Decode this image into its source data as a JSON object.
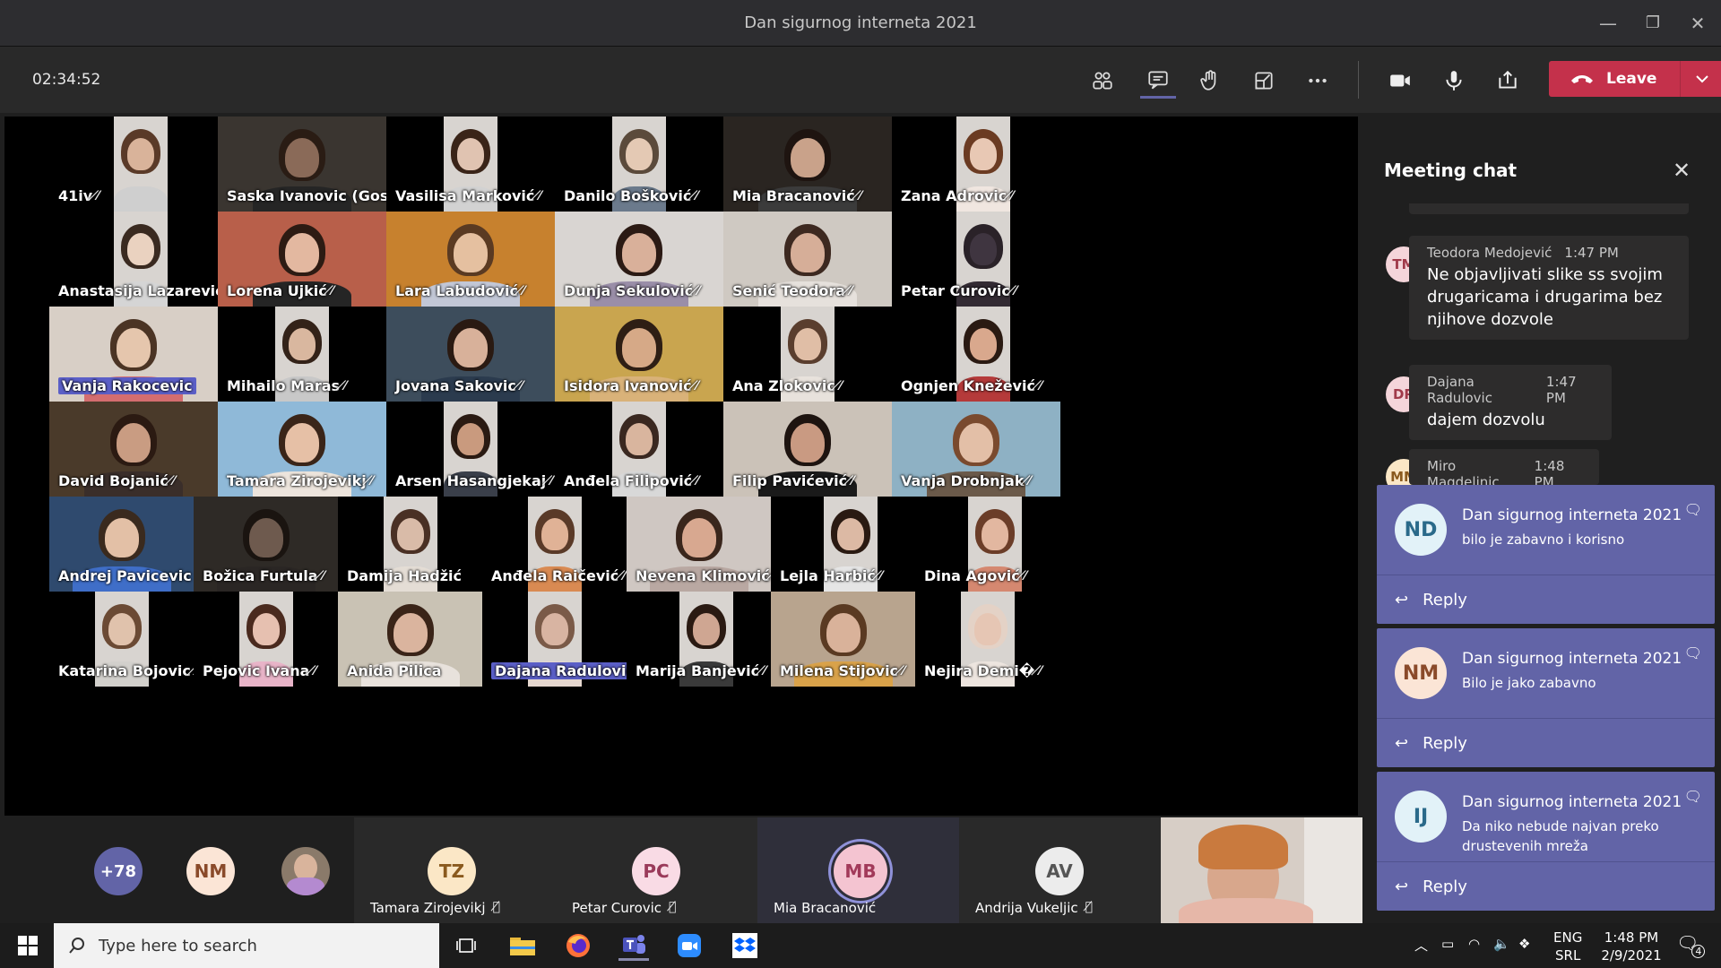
{
  "window": {
    "title": "Dan sigurnog interneta 2021",
    "minimize": "—",
    "restore": "❐",
    "close": "✕"
  },
  "toolbar": {
    "timer": "02:34:52",
    "leave_label": "Leave"
  },
  "tiles": [
    {
      "name": "41iv",
      "bg": "#000000",
      "face": "#d9b39a",
      "hair": "#5a3a28",
      "shirt": "#cfcfcf",
      "cam": "narrow",
      "mic": true
    },
    {
      "name": "Saska Ivanovic (Gost)",
      "bg": "#3a3530",
      "face": "#8a6a58",
      "hair": "#2a1c14",
      "shirt": "#252525",
      "cam": "full",
      "mic": true
    },
    {
      "name": "Vasilisa Marković",
      "bg": "#000000",
      "face": "#e0c3b1",
      "hair": "#3a2418",
      "shirt": "#d2d2d2",
      "cam": "narrow",
      "mic": true
    },
    {
      "name": "Danilo Bošković",
      "bg": "#000000",
      "face": "#e4c9b4",
      "hair": "#5b4a3b",
      "shirt": "#6b7a8c",
      "cam": "narrow",
      "mic": true
    },
    {
      "name": "Mia Bracanović",
      "bg": "#2a2521",
      "face": "#c9a28a",
      "hair": "#1e1410",
      "shirt": "#3b3b3b",
      "cam": "full",
      "mic": true
    },
    {
      "name": "Zana Adrovic",
      "bg": "#000000",
      "face": "#e8c8b4",
      "hair": "#6b3b22",
      "shirt": "#f0e6e0",
      "cam": "narrow",
      "mic": true
    },
    {
      "name": "Anastasija Lazarević",
      "bg": "#000000",
      "face": "#ead2c0",
      "hair": "#3a2a20",
      "shirt": "#d5d5d5",
      "cam": "narrow",
      "mic": true
    },
    {
      "name": "Lorena Ujkić",
      "bg": "#b85f4a",
      "face": "#e3b8a0",
      "hair": "#2d1b13",
      "shirt": "#252525",
      "cam": "full",
      "mic": true
    },
    {
      "name": "Lara Labudović",
      "bg": "#c7812e",
      "face": "#e5c0a0",
      "hair": "#5a3a22",
      "shirt": "#c2c7d6",
      "cam": "full",
      "mic": true
    },
    {
      "name": "Dunja Sekulović",
      "bg": "#d9d5d2",
      "face": "#d9b09a",
      "hair": "#2b1a14",
      "shirt": "#9a8ea8",
      "cam": "full",
      "mic": true
    },
    {
      "name": "Senić Teodora",
      "bg": "#cfc9c2",
      "face": "#d6ae98",
      "hair": "#3d2920",
      "shirt": "#e6e1dc",
      "cam": "full",
      "mic": true
    },
    {
      "name": "Petar Curovic",
      "bg": "#000000",
      "face": "#3f3540",
      "hair": "#2a2228",
      "shirt": "#332b33",
      "cam": "narrow",
      "mic": true
    },
    {
      "name": "Vanja Rakocevic",
      "bg": "#d8cfc6",
      "face": "#e5c6ad",
      "hair": "#4b3424",
      "shirt": "#d46d6f",
      "cam": "full",
      "mic": false,
      "hl": true
    },
    {
      "name": "Mihailo Maras",
      "bg": "#000000",
      "face": "#d9b79f",
      "hair": "#332218",
      "shirt": "#c8c8c8",
      "cam": "narrow",
      "mic": true
    },
    {
      "name": "Jovana Sakovic",
      "bg": "#3d4d5c",
      "face": "#d8b19a",
      "hair": "#2a1a12",
      "shirt": "#2b3b4e",
      "cam": "full",
      "mic": true
    },
    {
      "name": "Isidora Ivanović",
      "bg": "#c9a54f",
      "face": "#d6a987",
      "hair": "#2e1e14",
      "shirt": "#d9b279",
      "cam": "full",
      "mic": true
    },
    {
      "name": "Ana Zlokovic",
      "bg": "#000000",
      "face": "#e0bea6",
      "hair": "#5a3e2e",
      "shirt": "#e8e2dc",
      "cam": "narrow",
      "mic": true
    },
    {
      "name": "Ognjen Knežević",
      "bg": "#000000",
      "face": "#d9a88d",
      "hair": "#2a1a12",
      "shirt": "#b53a3a",
      "cam": "narrow",
      "mic": true
    },
    {
      "name": "David Bojanić",
      "bg": "#4a3a2a",
      "face": "#c99c82",
      "hair": "#2b1a12",
      "shirt": "#3a2e2a",
      "cam": "full",
      "mic": true
    },
    {
      "name": "Tamara Zirojevikj",
      "bg": "#8fb9d8",
      "face": "#e6c0a6",
      "hair": "#3a2519",
      "shirt": "#ece4dc",
      "cam": "full",
      "mic": true
    },
    {
      "name": "Arsen Hasangjekaj",
      "bg": "#000000",
      "face": "#c99a7e",
      "hair": "#2a1a12",
      "shirt": "#3a3f4a",
      "cam": "narrow",
      "mic": true
    },
    {
      "name": "Anđela Filipović",
      "bg": "#000000",
      "face": "#d9b59e",
      "hair": "#3a2820",
      "shirt": "#d8d8d8",
      "cam": "narrow",
      "mic": true
    },
    {
      "name": "Filip Pavićević",
      "bg": "#cbc2b8",
      "face": "#c99a82",
      "hair": "#1e1410",
      "shirt": "#1a1a1a",
      "cam": "full",
      "mic": true
    },
    {
      "name": "Vanja Drobnjak",
      "bg": "#8eb1c4",
      "face": "#e3bfa7",
      "hair": "#7a4a2e",
      "shirt": "#6b5a4a",
      "cam": "full",
      "mic": true
    },
    {
      "name": "Andrej Pavicevic O...",
      "bg": "#2f4a6e",
      "face": "#e3c0a6",
      "hair": "#3a2a1e",
      "shirt": "#3f6ec8",
      "cam": "full",
      "mic": true
    },
    {
      "name": "Božica Furtula",
      "bg": "#2e2a26",
      "face": "#6e5a4e",
      "hair": "#1a1410",
      "shirt": "#2a2624",
      "cam": "full",
      "mic": true
    },
    {
      "name": "Damija Hadžić",
      "bg": "#000000",
      "face": "#d9bba8",
      "hair": "#4a3024",
      "shirt": "#e4ddd5",
      "cam": "narrow",
      "mic": false
    },
    {
      "name": "Anđela Raičević",
      "bg": "#000000",
      "face": "#e0b296",
      "hair": "#5a3a28",
      "shirt": "#d98a52",
      "cam": "narrow",
      "mic": true
    },
    {
      "name": "Nevena Klimović",
      "bg": "#cfc7c2",
      "face": "#d8a890",
      "hair": "#3a261c",
      "shirt": "#b9a8a2",
      "cam": "full",
      "mic": true
    },
    {
      "name": "Lejla Harbić",
      "bg": "#000000",
      "face": "#dcb9a4",
      "hair": "#2a1a12",
      "shirt": "#e5e5e5",
      "cam": "narrow",
      "mic": true
    },
    {
      "name": "Dina Agović",
      "bg": "#000000",
      "face": "#e2b7a0",
      "hair": "#6b3d28",
      "shirt": "#d58870",
      "cam": "narrow",
      "mic": true
    },
    {
      "name": "Katarina Bojovic",
      "bg": "#000000",
      "face": "#e0c2ac",
      "hair": "#6b4a34",
      "shirt": "#d2d0cc",
      "cam": "narrow",
      "mic": true
    },
    {
      "name": "Pejovic Ivana",
      "bg": "#000000",
      "face": "#e6c0b0",
      "hair": "#4a2a1e",
      "shirt": "#e8b4c8",
      "cam": "narrow",
      "mic": true
    },
    {
      "name": "Anida Pilica",
      "bg": "#c9c2b4",
      "face": "#dab49e",
      "hair": "#3a2418",
      "shirt": "#e8e2dc",
      "cam": "full",
      "mic": false
    },
    {
      "name": "Dajana Radulovic",
      "bg": "#000000",
      "face": "#d8b4a2",
      "hair": "#7a5a48",
      "shirt": "#e6d8d0",
      "cam": "narrow",
      "mic": false,
      "hl": true
    },
    {
      "name": "Marija Banjević",
      "bg": "#000000",
      "face": "#cfa692",
      "hair": "#2a1a12",
      "shirt": "#3a3a3a",
      "cam": "narrow",
      "mic": true
    },
    {
      "name": "Milena Stijovic",
      "bg": "#b8a48e",
      "face": "#d9b29a",
      "hair": "#5a3a22",
      "shirt": "#d9a24a",
      "cam": "full",
      "mic": true
    },
    {
      "name": "Nejira Demi�",
      "bg": "#000000",
      "face": "#e6c6b4",
      "hair": "#e4d2c6",
      "shirt": "#ede5df",
      "cam": "narrow",
      "mic": true
    }
  ],
  "participants_strip": {
    "overflow": "+78",
    "items": [
      {
        "initials": "NM",
        "name": "",
        "bg": "#fbe5d6",
        "fg": "#8a4a2a"
      },
      {
        "initials": "TZ",
        "name": "Tamara Zirojevikj",
        "bg": "#fbe7c6",
        "fg": "#8a5a1e",
        "mic": true
      },
      {
        "initials": "PC",
        "name": "Petar Curovic",
        "bg": "#f9dbe5",
        "fg": "#9a3a5a",
        "mic": true
      },
      {
        "initials": "MB",
        "name": "Mia Bracanović",
        "bg": "#f4c4d1",
        "fg": "#a23a5a",
        "mic": false
      },
      {
        "initials": "AV",
        "name": "Andrija Vukeljic",
        "bg": "#ececec",
        "fg": "#555555",
        "mic": true
      }
    ]
  },
  "chat": {
    "title": "Meeting chat",
    "messages": [
      {
        "initials": "TM",
        "author": "Teodora Medojević",
        "time": "1:47 PM",
        "text": "Ne objavljivati slike ss svojim drugaricama i drugarima bez njihove dozvole",
        "bg": "#f4d5da",
        "fg": "#a03a4a"
      },
      {
        "initials": "DR",
        "author": "Dajana Radulovic",
        "time": "1:47 PM",
        "text": "dajem dozvolu",
        "bg": "#f4d5da",
        "fg": "#a03a4a"
      },
      {
        "initials": "MM",
        "author": "Miro Magdelinic",
        "time": "1:48 PM",
        "text": "",
        "bg": "#fbe7c6",
        "fg": "#8a5a1e"
      }
    ]
  },
  "notifications": [
    {
      "initials": "ND",
      "title": "Dan sigurnog interneta 2021",
      "body": "bilo je zabavno i korisno",
      "reply": "Reply",
      "bg": "#e2f2f8",
      "fg": "#2a6a8a"
    },
    {
      "initials": "NM",
      "title": "Dan sigurnog interneta 2021",
      "body": "Bilo je jako zabavno",
      "reply": "Reply",
      "bg": "#fbe5d6",
      "fg": "#8a4a2a"
    },
    {
      "initials": "IJ",
      "title": "Dan sigurnog interneta 2021",
      "body": "Da niko nebude najvan preko drustevenih mreža",
      "reply": "Reply",
      "bg": "#e2f2f8",
      "fg": "#2a6a8a"
    }
  ],
  "taskbar": {
    "search_placeholder": "Type here to search",
    "lang1": "ENG",
    "lang2": "SRL",
    "time": "1:48 PM",
    "date": "2/9/2021",
    "notif_count": "4"
  },
  "colors": {
    "accent": "#6264a7",
    "leave": "#c4314b"
  }
}
